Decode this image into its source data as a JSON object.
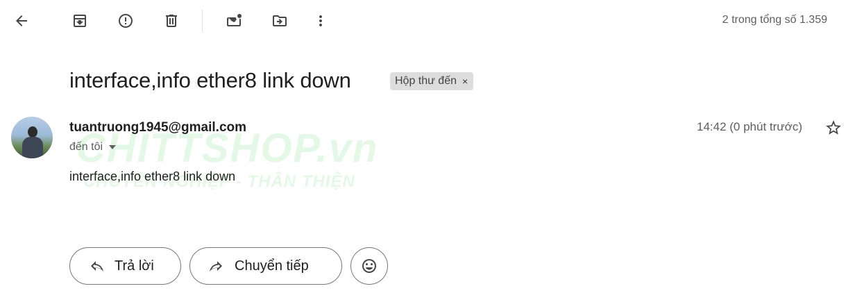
{
  "toolbar": {
    "back_icon": "arrow-back-icon",
    "archive_icon": "archive-icon",
    "spam_icon": "report-spam-icon",
    "delete_icon": "delete-icon",
    "mark_unread_icon": "mark-unread-icon",
    "move_icon": "move-to-folder-icon",
    "more_icon": "more-vert-icon",
    "pager_text": "2 trong tổng số 1.359"
  },
  "email": {
    "subject": "interface,info ether8 link down",
    "label": {
      "name": "Hộp thư đến",
      "remove_symbol": "×"
    },
    "sender": "tuantruong1945@gmail.com",
    "recipient": "đến tôi",
    "time": "14:42 (0 phút trước)",
    "star_icon": "star-outline-icon",
    "body": "interface,info ether8 link down"
  },
  "watermark": {
    "main": "CHITTSHOP.vn",
    "sub": "CHUYÊN NGHIỆP - THÂN THIỆN"
  },
  "actions": {
    "reply_label": "Trả lời",
    "forward_label": "Chuyển tiếp",
    "emoji_icon": "emoji-reaction-icon"
  },
  "colors": {
    "icon": "#444746",
    "text_primary": "#1f1f1f",
    "text_secondary": "#5e5e5e",
    "chip_bg": "#dddddd",
    "button_border": "#747775",
    "watermark": "#2ecc40"
  }
}
